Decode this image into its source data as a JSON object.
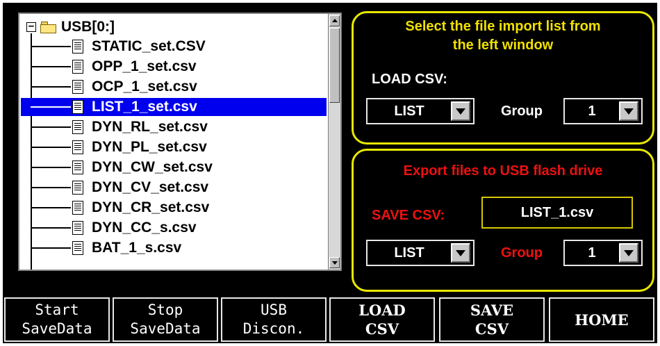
{
  "file_tree": {
    "root_label": "USB[0:]",
    "files": [
      {
        "label": "STATIC_set.CSV",
        "selected": false
      },
      {
        "label": "OPP_1_set.csv",
        "selected": false
      },
      {
        "label": "OCP_1_set.csv",
        "selected": false
      },
      {
        "label": "LIST_1_set.csv",
        "selected": true
      },
      {
        "label": "DYN_RL_set.csv",
        "selected": false
      },
      {
        "label": "DYN_PL_set.csv",
        "selected": false
      },
      {
        "label": "DYN_CW_set.csv",
        "selected": false
      },
      {
        "label": "DYN_CV_set.csv",
        "selected": false
      },
      {
        "label": "DYN_CR_set.csv",
        "selected": false
      },
      {
        "label": "DYN_CC_s.csv",
        "selected": false
      },
      {
        "label": "BAT_1_s.csv",
        "selected": false
      }
    ]
  },
  "import_panel": {
    "title_line1": "Select the file import list from",
    "title_line2": "the left window",
    "load_label": "LOAD CSV:",
    "mode_value": "LIST",
    "group_label": "Group",
    "group_value": "1"
  },
  "export_panel": {
    "title": "Export files to USB flash drive",
    "save_label": "SAVE CSV:",
    "filename": "LIST_1.csv",
    "mode_value": "LIST",
    "group_label": "Group",
    "group_value": "1"
  },
  "softkeys": {
    "start_line1": "Start",
    "start_line2": "SaveData",
    "stop_line1": "Stop",
    "stop_line2": "SaveData",
    "usb_line1": "USB",
    "usb_line2": "Discon.",
    "load_line1": "LOAD",
    "load_line2": "CSV",
    "save_line1": "SAVE",
    "save_line2": "CSV",
    "home": "HOME"
  },
  "colors": {
    "background": "#000000",
    "panel_border": "#e8e800",
    "import_title": "#f0e000",
    "export_accent": "#ee1010",
    "selection": "#0000ee"
  }
}
